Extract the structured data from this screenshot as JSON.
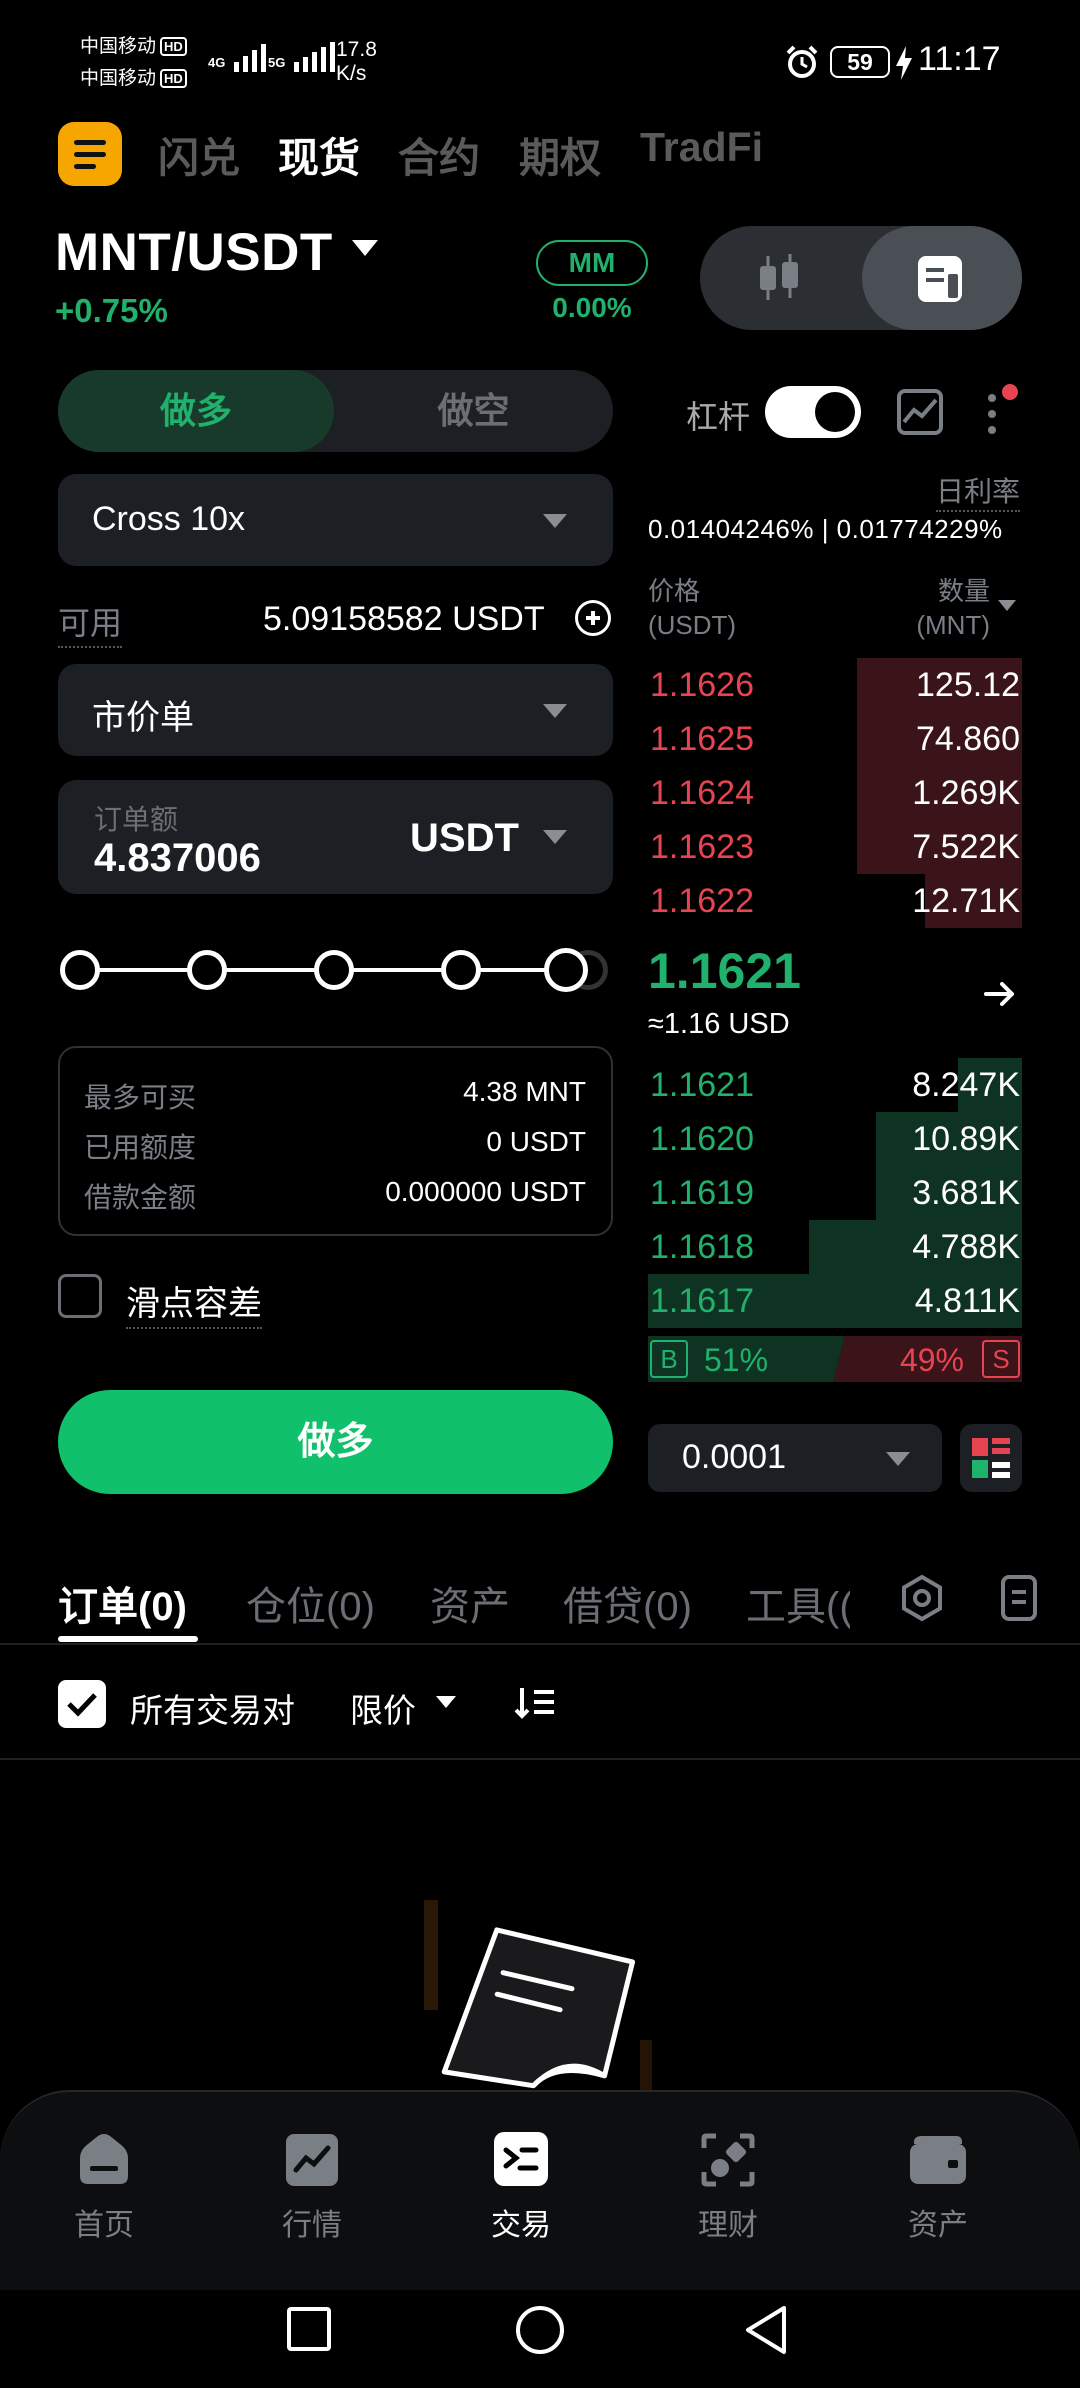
{
  "status_bar": {
    "carrier1": "中国移动",
    "carrier2": "中国移动",
    "hd": "HD",
    "net1": "4G",
    "net2": "5G",
    "speed_value": "17.8",
    "speed_unit": "K/s",
    "battery": "59",
    "time": "11:17"
  },
  "top_nav": {
    "tabs": [
      "闪兑",
      "现货",
      "合约",
      "期权",
      "TradFi"
    ],
    "active_index": 1
  },
  "pair": {
    "symbol": "MNT/USDT",
    "change": "+0.75%",
    "mm_label": "MM",
    "mm_value": "0.00%"
  },
  "order_form": {
    "long_label": "做多",
    "short_label": "做空",
    "margin_mode": "Cross 10x",
    "available_label": "可用",
    "available_value": "5.09158582 USDT",
    "order_type": "市价单",
    "amount_label": "订单额",
    "amount_value": "4.837006",
    "amount_unit": "USDT",
    "slider_percent": 100,
    "max_buy_label": "最多可买",
    "max_buy_value": "4.38 MNT",
    "used_label": "已用额度",
    "used_value": "0 USDT",
    "borrow_label": "借款金额",
    "borrow_value": "0.000000 USDT",
    "slippage_label": "滑点容差",
    "submit_label": "做多"
  },
  "order_book": {
    "leverage_label": "杠杆",
    "rate_label": "日利率",
    "rate_values": "0.01404246% | 0.01774229%",
    "price_header": "价格",
    "price_unit": "(USDT)",
    "qty_header": "数量",
    "qty_unit": "(MNT)",
    "asks": [
      {
        "price": "1.1626",
        "qty": "125.12",
        "depth": 0.44
      },
      {
        "price": "1.1625",
        "qty": "74.860",
        "depth": 0.44
      },
      {
        "price": "1.1624",
        "qty": "1.269K",
        "depth": 0.44
      },
      {
        "price": "1.1623",
        "qty": "7.522K",
        "depth": 0.44
      },
      {
        "price": "1.1622",
        "qty": "12.71K",
        "depth": 0.26
      }
    ],
    "mid_price": "1.1621",
    "mid_usd": "≈1.16 USD",
    "bids": [
      {
        "price": "1.1621",
        "qty": "8.247K",
        "depth": 0.17
      },
      {
        "price": "1.1620",
        "qty": "10.89K",
        "depth": 0.39
      },
      {
        "price": "1.1619",
        "qty": "3.681K",
        "depth": 0.39
      },
      {
        "price": "1.1618",
        "qty": "4.788K",
        "depth": 0.57
      },
      {
        "price": "1.1617",
        "qty": "4.811K",
        "depth": 1.0
      }
    ],
    "buy_tag": "B",
    "buy_ratio": "51%",
    "sell_ratio": "49%",
    "sell_tag": "S",
    "depth_step": "0.0001"
  },
  "bottom_tabs": {
    "tabs": [
      "订单(0)",
      "仓位(0)",
      "资产",
      "借贷(0)",
      "工具(("
    ],
    "all_pairs_label": "所有交易对",
    "filter_label": "限价"
  },
  "bottom_nav": {
    "items": [
      "首页",
      "行情",
      "交易",
      "理财",
      "资产"
    ],
    "active_index": 2
  },
  "colors": {
    "green": "#20b26c",
    "red": "#e84351",
    "accent": "#f7a600"
  }
}
